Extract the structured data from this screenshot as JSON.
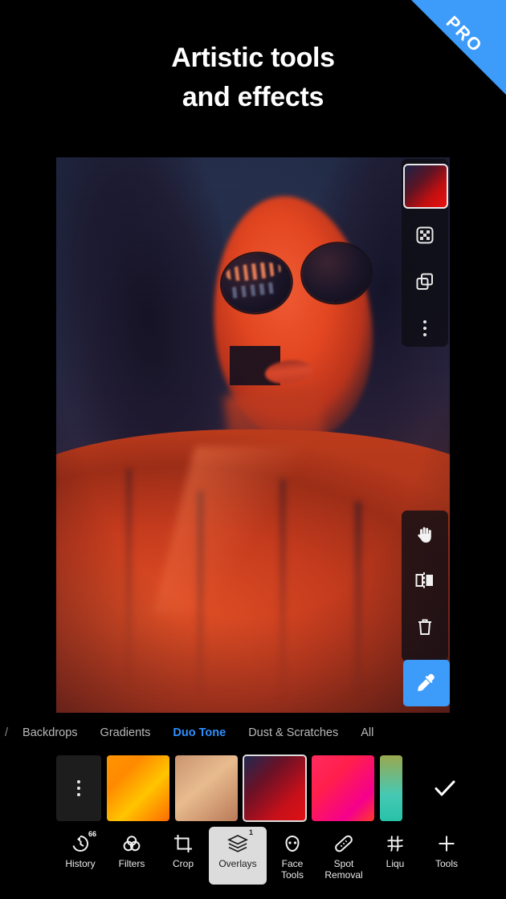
{
  "ribbon": {
    "label": "PRO",
    "color": "#3d9bfa"
  },
  "headline": {
    "line1": "Artistic tools",
    "line2": "and effects"
  },
  "canvas": {
    "name": "duotone-portrait-preview",
    "description": "Portrait of a woman in sunglasses and a coat with a red and navy duo tone effect applied"
  },
  "right_panel_top": {
    "color_swatch": {
      "label": "",
      "gradient": "linear-gradient(135deg,#1a2348,#c40f10)"
    },
    "items": [
      {
        "name": "blend-mode-icon",
        "label": ""
      },
      {
        "name": "duplicate-layer-icon",
        "label": ""
      },
      {
        "name": "more-options-icon",
        "label": ""
      }
    ]
  },
  "right_panel_bottom": {
    "items": [
      {
        "name": "hand-icon",
        "label": ""
      },
      {
        "name": "flip-icon",
        "label": ""
      },
      {
        "name": "trash-icon",
        "label": ""
      }
    ],
    "eyedropper": {
      "name": "eyedropper-icon",
      "label": "",
      "color": "#3d9bfa"
    }
  },
  "tabs": {
    "clipped_left": "/",
    "items": [
      {
        "label": "Backdrops",
        "active": false
      },
      {
        "label": "Gradients",
        "active": false
      },
      {
        "label": "Duo Tone",
        "active": true
      },
      {
        "label": "Dust & Scratches",
        "active": false
      },
      {
        "label": "All",
        "active": false
      }
    ],
    "active_color": "#2f8fff"
  },
  "swatches": {
    "menu_label": "",
    "items": [
      {
        "name": "swatch-orange",
        "gradient": "linear-gradient(135deg,#ff9500 0%,#ff8a00 28%,#ffc400 60%,#ff6a00 100%)",
        "selected": false
      },
      {
        "name": "swatch-tan",
        "gradient": "linear-gradient(140deg,#c99470 0%,#e8bb8e 45%,#b97a58 100%)",
        "selected": false
      },
      {
        "name": "swatch-red",
        "gradient": "linear-gradient(135deg,#1e2a52 0%,#6b1126 35%,#c6101a 72%,#e01015 100%)",
        "selected": true
      },
      {
        "name": "swatch-pink",
        "gradient": "linear-gradient(135deg,#ff2b5e 0%,#ff1f4d 35%,#f5008c 75%,#ff3a2a 100%)",
        "selected": false
      },
      {
        "name": "swatch-teal",
        "gradient": "linear-gradient(180deg,#9aa84f 0%,#46c9b4 60%,#27c2a8 100%)",
        "selected": false
      }
    ],
    "confirm_label": ""
  },
  "bottom_toolbar": {
    "items": [
      {
        "name": "history",
        "label": "History",
        "icon": "undo-icon",
        "badge": "66",
        "selected": false
      },
      {
        "name": "filters",
        "label": "Filters",
        "icon": "filters-icon",
        "badge": "",
        "selected": false
      },
      {
        "name": "crop",
        "label": "Crop",
        "icon": "crop-icon",
        "badge": "",
        "selected": false
      },
      {
        "name": "overlays",
        "label": "Overlays",
        "icon": "layers-icon",
        "badge": "1",
        "selected": true
      },
      {
        "name": "face-tools",
        "label": "Face\nTools",
        "icon": "face-icon",
        "badge": "",
        "selected": false
      },
      {
        "name": "spot-removal",
        "label": "Spot\nRemoval",
        "icon": "bandage-icon",
        "badge": "",
        "selected": false
      },
      {
        "name": "liquify",
        "label": "Liqu",
        "icon": "mesh-icon",
        "badge": "",
        "selected": false
      },
      {
        "name": "tools",
        "label": "Tools",
        "icon": "plus-icon",
        "badge": "",
        "selected": false
      }
    ]
  }
}
